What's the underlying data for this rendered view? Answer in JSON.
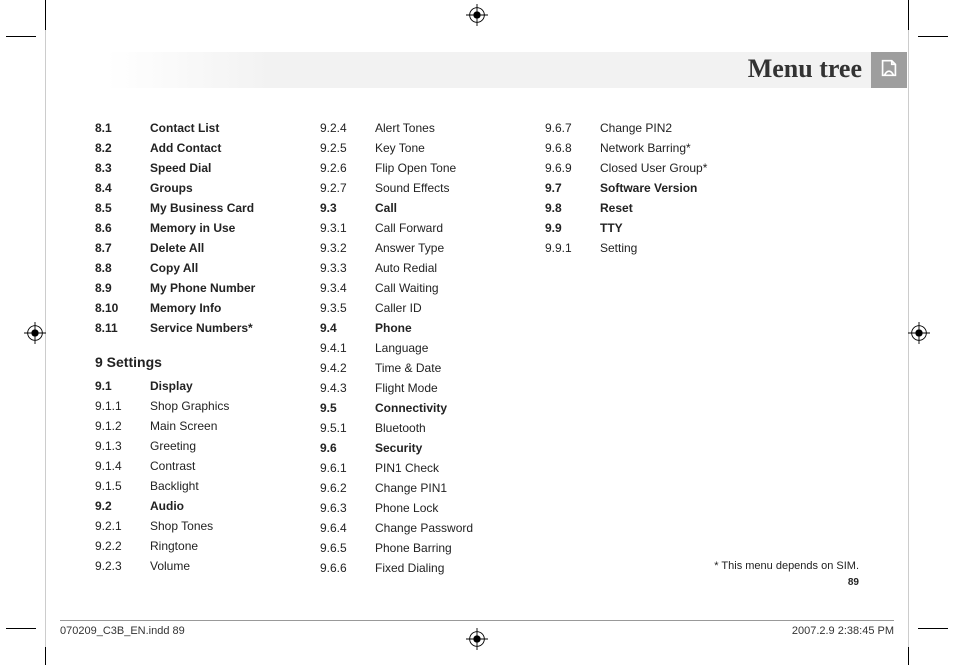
{
  "header": {
    "title": "Menu tree"
  },
  "col1": [
    {
      "n": "8.1",
      "l": "Contact List",
      "b": true
    },
    {
      "n": "8.2",
      "l": "Add Contact",
      "b": true
    },
    {
      "n": "8.3",
      "l": "Speed Dial",
      "b": true
    },
    {
      "n": "8.4",
      "l": "Groups",
      "b": true
    },
    {
      "n": "8.5",
      "l": "My Business Card",
      "b": true
    },
    {
      "n": "8.6",
      "l": "Memory in Use",
      "b": true
    },
    {
      "n": "8.7",
      "l": "Delete All",
      "b": true
    },
    {
      "n": "8.8",
      "l": "Copy All",
      "b": true
    },
    {
      "n": "8.9",
      "l": "My Phone Number",
      "b": true
    },
    {
      "n": "8.10",
      "l": "Memory Info",
      "b": true
    },
    {
      "n": "8.11",
      "l": "Service Numbers*",
      "b": true
    }
  ],
  "section9": "9 Settings",
  "col1b": [
    {
      "n": "9.1",
      "l": "Display",
      "b": true
    },
    {
      "n": "9.1.1",
      "l": "Shop Graphics"
    },
    {
      "n": "9.1.2",
      "l": "Main Screen"
    },
    {
      "n": "9.1.3",
      "l": "Greeting"
    },
    {
      "n": "9.1.4",
      "l": "Contrast"
    },
    {
      "n": "9.1.5",
      "l": "Backlight"
    },
    {
      "n": "9.2",
      "l": "Audio",
      "b": true
    },
    {
      "n": "9.2.1",
      "l": "Shop Tones"
    },
    {
      "n": "9.2.2",
      "l": "Ringtone"
    },
    {
      "n": "9.2.3",
      "l": "Volume"
    }
  ],
  "col2": [
    {
      "n": "9.2.4",
      "l": "Alert Tones"
    },
    {
      "n": "9.2.5",
      "l": "Key Tone"
    },
    {
      "n": "9.2.6",
      "l": "Flip Open Tone"
    },
    {
      "n": "9.2.7",
      "l": "Sound Effects"
    },
    {
      "n": "9.3",
      "l": "Call",
      "b": true
    },
    {
      "n": "9.3.1",
      "l": "Call Forward"
    },
    {
      "n": "9.3.2",
      "l": "Answer Type"
    },
    {
      "n": "9.3.3",
      "l": "Auto Redial"
    },
    {
      "n": "9.3.4",
      "l": "Call Waiting"
    },
    {
      "n": "9.3.5",
      "l": "Caller ID"
    },
    {
      "n": "9.4",
      "l": "Phone",
      "b": true
    },
    {
      "n": "9.4.1",
      "l": "Language"
    },
    {
      "n": "9.4.2",
      "l": "Time & Date"
    },
    {
      "n": "9.4.3",
      "l": "Flight Mode"
    },
    {
      "n": "9.5",
      "l": "Connectivity",
      "b": true
    },
    {
      "n": "9.5.1",
      "l": "Bluetooth"
    },
    {
      "n": "9.6",
      "l": "Security",
      "b": true
    },
    {
      "n": "9.6.1",
      "l": "PIN1 Check"
    },
    {
      "n": "9.6.2",
      "l": "Change PIN1"
    },
    {
      "n": "9.6.3",
      "l": "Phone Lock"
    },
    {
      "n": "9.6.4",
      "l": "Change Password"
    },
    {
      "n": "9.6.5",
      "l": "Phone Barring"
    },
    {
      "n": "9.6.6",
      "l": "Fixed Dialing"
    }
  ],
  "col3": [
    {
      "n": "9.6.7",
      "l": "Change PIN2"
    },
    {
      "n": "9.6.8",
      "l": "Network Barring*"
    },
    {
      "n": "9.6.9",
      "l": "Closed User Group*"
    },
    {
      "n": "9.7",
      "l": "Software Version",
      "b": true
    },
    {
      "n": "9.8",
      "l": "Reset",
      "b": true
    },
    {
      "n": "9.9",
      "l": "TTY",
      "b": true
    },
    {
      "n": "9.9.1",
      "l": "Setting"
    }
  ],
  "footnote": "* This menu depends on SIM.",
  "pagenum": "89",
  "imposition": {
    "file": "070209_C3B_EN.indd   89",
    "date": "2007.2.9   2:38:45 PM"
  }
}
